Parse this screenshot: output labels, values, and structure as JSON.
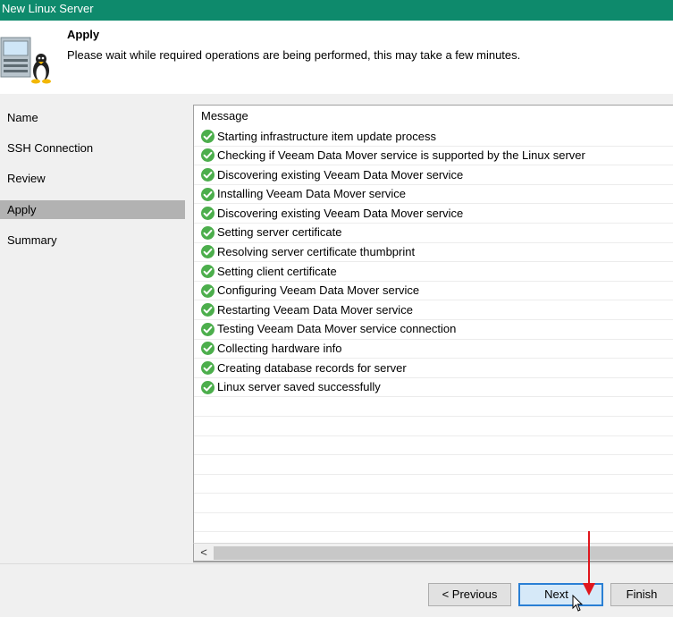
{
  "window": {
    "title": "New Linux Server"
  },
  "header": {
    "title": "Apply",
    "description": "Please wait while required operations are being performed, this may take a few minutes.",
    "icon": "linux-server-icon"
  },
  "sidebar": {
    "items": [
      {
        "label": "Name",
        "active": false
      },
      {
        "label": "SSH Connection",
        "active": false
      },
      {
        "label": "Review",
        "active": false
      },
      {
        "label": "Apply",
        "active": true
      },
      {
        "label": "Summary",
        "active": false
      }
    ]
  },
  "log": {
    "column_header": "Message",
    "status_icon": "success-check-icon",
    "rows": [
      {
        "message": "Starting infrastructure item update process"
      },
      {
        "message": "Checking if Veeam Data Mover service is supported by the Linux server"
      },
      {
        "message": "Discovering existing Veeam Data Mover service"
      },
      {
        "message": "Installing Veeam Data Mover service"
      },
      {
        "message": "Discovering existing Veeam Data Mover service"
      },
      {
        "message": "Setting server certificate"
      },
      {
        "message": "Resolving server certificate thumbprint"
      },
      {
        "message": "Setting client certificate"
      },
      {
        "message": "Configuring Veeam Data Mover service"
      },
      {
        "message": "Restarting Veeam Data Mover service"
      },
      {
        "message": "Testing Veeam Data Mover service connection"
      },
      {
        "message": "Collecting hardware info"
      },
      {
        "message": "Creating database records for server"
      },
      {
        "message": "Linux server saved successfully"
      }
    ],
    "empty_rows": 8
  },
  "scrollbar": {
    "left_arrow": "<"
  },
  "footer": {
    "previous_label": "< Previous",
    "next_label": "Next",
    "finish_label": "Finish"
  },
  "colors": {
    "titlebar": "#0e8a6c",
    "success": "#4cae4c",
    "active_step": "#b2b2b2",
    "annotation_arrow": "#e0161d",
    "next_button_border": "#2a7fd4"
  }
}
